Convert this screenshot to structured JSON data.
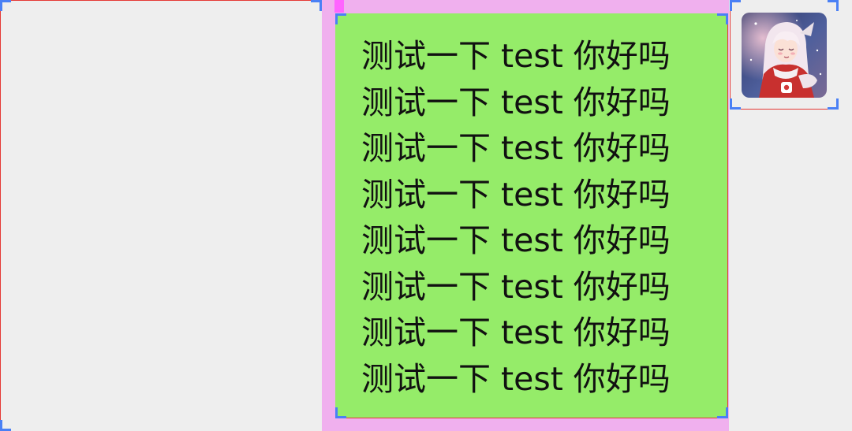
{
  "chat": {
    "message": {
      "lines": [
        "测试一下 test 你好吗",
        "测试一下 test 你好吗",
        "测试一下 test 你好吗",
        "测试一下 test 你好吗",
        "测试一下 test 你好吗",
        "测试一下 test 你好吗",
        "测试一下 test 你好吗",
        "测试一下 test 你好吗"
      ]
    },
    "avatar": {
      "icon": "anime-girl-avatar"
    }
  },
  "colors": {
    "bubble": "#95ec69",
    "container": "#f0b0ee",
    "background": "#eeeeee",
    "layout_bounds": "#4a80f5",
    "layout_border": "#e53935"
  }
}
